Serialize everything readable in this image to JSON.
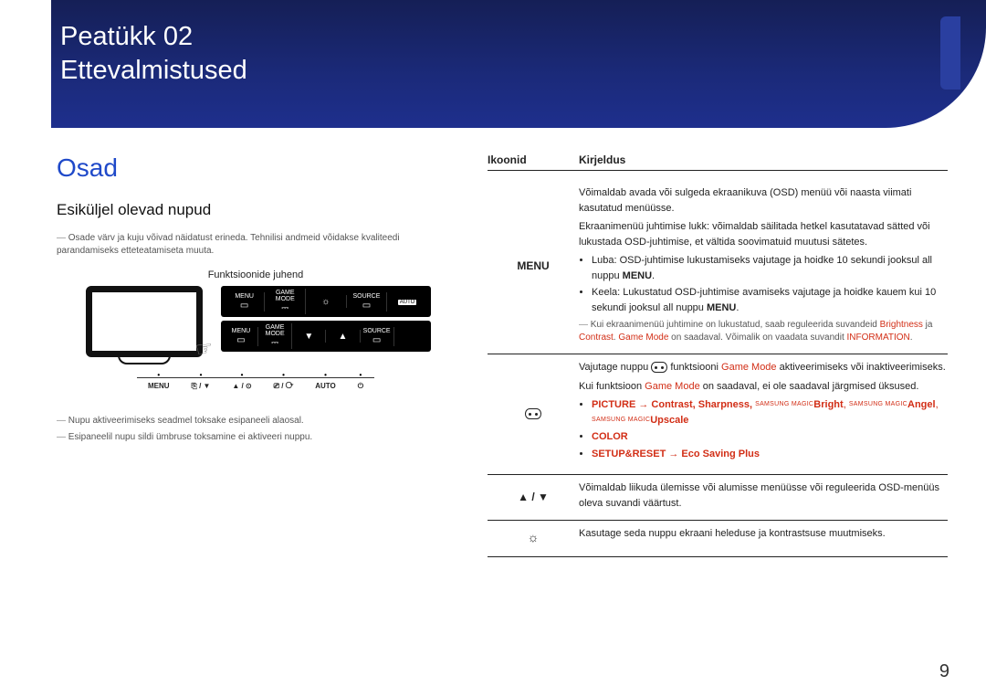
{
  "banner": {
    "chapter_prefix": "Peatükk",
    "chapter_number": "02",
    "chapter_title": "Ettevalmistused"
  },
  "left": {
    "section": "Osad",
    "subtitle": "Esiküljel olevad nupud",
    "note1": "Osade värv ja kuju võivad näidatust erineda. Tehnilisi andmeid võidakse kvaliteedi parandamiseks etteteatamiseta muuta.",
    "figure_caption": "Funktsioonide juhend",
    "guide_labels": {
      "menu": "MENU",
      "game_mode": "GAME MODE",
      "source": "SOURCE",
      "auto": "AUTO"
    },
    "button_labels": {
      "menu": "MENU",
      "pair1": "⎘ / ▼",
      "pair2": "▲ / ⊙",
      "pair3": "⎚ / ⟳",
      "auto": "AUTO",
      "power": "⏻"
    },
    "note2": "Nupu aktiveerimiseks seadmel toksake esipaneeli alaosal.",
    "note3": "Esipaneelil nupu sildi ümbruse toksamine ei aktiveeri nuppu."
  },
  "table": {
    "head_icon": "Ikoonid",
    "head_desc": "Kirjeldus",
    "row_menu": {
      "icon": "MENU",
      "p1": "Võimaldab avada või sulgeda ekraanikuva (OSD) menüü või naasta viimati kasutatud menüüsse.",
      "p2": "Ekraanimenüü juhtimise lukk: võimaldab säilitada hetkel kasutatavad sätted või lukustada OSD-juhtimise, et vältida soovimatuid muutusi sätetes.",
      "b1_prefix": "Luba: OSD-juhtimise lukustamiseks vajutage ja hoidke 10 sekundi jooksul all nuppu ",
      "b1_bold": "MENU",
      "b1_suffix": ".",
      "b2_prefix": "Keela: Lukustatud OSD-juhtimise avamiseks vajutage ja hoidke kauem kui 10 sekundi jooksul all nuppu ",
      "b2_bold": "MENU",
      "b2_suffix": ".",
      "note_pre": "Kui ekraanimenüü juhtimine on lukustatud, saab reguleerida suvandeid ",
      "note_brightness": "Brightness",
      "note_and": " ja ",
      "note_contrast": "Contrast",
      "note_gm_sentence": ". ",
      "note_game_mode": "Game Mode",
      "note_gm_tail": " on saadaval. Võimalik on vaadata suvandit ",
      "note_info": "INFORMATION",
      "note_period": "."
    },
    "row_game": {
      "p1_pre": "Vajutage nuppu ",
      "p1_mid": " funktsiooni ",
      "p1_game_mode": "Game Mode",
      "p1_post": " aktiveerimiseks või inaktiveerimiseks.",
      "p2_pre": "Kui funktsioon ",
      "p2_game_mode": "Game Mode",
      "p2_post": " on saadaval, ei ole saadaval järgmised üksused.",
      "b1_picture": "PICTURE",
      "b1_arrow": " → ",
      "b1_list": "Contrast, Sharpness, ",
      "b1_magic_bright": "Bright",
      "b1_sep1": ", ",
      "b1_magic_angel": "Angel",
      "b1_sep2": ", ",
      "b1_magic_upscale": "Upscale",
      "b1_magic_tag": "SAMSUNG MAGIC",
      "b2": "COLOR",
      "b3_setup": "SETUP&RESET",
      "b3_arrow": " → ",
      "b3_eco": "Eco Saving Plus"
    },
    "row_arrows": {
      "icon": "▲ / ▼",
      "desc": "Võimaldab liikuda ülemisse või alumisse menüüsse või reguleerida OSD-menüüs oleva suvandi väärtust."
    },
    "row_brightness": {
      "desc": "Kasutage seda nuppu ekraani heleduse ja kontrastsuse muutmiseks."
    }
  },
  "page_number": "9"
}
